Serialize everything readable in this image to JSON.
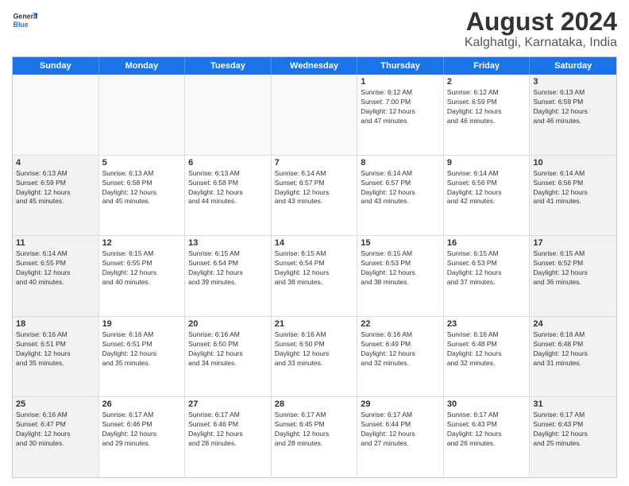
{
  "logo": {
    "line1": "General",
    "line2": "Blue"
  },
  "title": "August 2024",
  "subtitle": "Kalghatgi, Karnataka, India",
  "days": [
    "Sunday",
    "Monday",
    "Tuesday",
    "Wednesday",
    "Thursday",
    "Friday",
    "Saturday"
  ],
  "weeks": [
    [
      {
        "day": "",
        "content": ""
      },
      {
        "day": "",
        "content": ""
      },
      {
        "day": "",
        "content": ""
      },
      {
        "day": "",
        "content": ""
      },
      {
        "day": "1",
        "content": "Sunrise: 6:12 AM\nSunset: 7:00 PM\nDaylight: 12 hours\nand 47 minutes."
      },
      {
        "day": "2",
        "content": "Sunrise: 6:12 AM\nSunset: 6:59 PM\nDaylight: 12 hours\nand 46 minutes."
      },
      {
        "day": "3",
        "content": "Sunrise: 6:13 AM\nSunset: 6:59 PM\nDaylight: 12 hours\nand 46 minutes."
      }
    ],
    [
      {
        "day": "4",
        "content": "Sunrise: 6:13 AM\nSunset: 6:59 PM\nDaylight: 12 hours\nand 45 minutes."
      },
      {
        "day": "5",
        "content": "Sunrise: 6:13 AM\nSunset: 6:58 PM\nDaylight: 12 hours\nand 45 minutes."
      },
      {
        "day": "6",
        "content": "Sunrise: 6:13 AM\nSunset: 6:58 PM\nDaylight: 12 hours\nand 44 minutes."
      },
      {
        "day": "7",
        "content": "Sunrise: 6:14 AM\nSunset: 6:57 PM\nDaylight: 12 hours\nand 43 minutes."
      },
      {
        "day": "8",
        "content": "Sunrise: 6:14 AM\nSunset: 6:57 PM\nDaylight: 12 hours\nand 43 minutes."
      },
      {
        "day": "9",
        "content": "Sunrise: 6:14 AM\nSunset: 6:56 PM\nDaylight: 12 hours\nand 42 minutes."
      },
      {
        "day": "10",
        "content": "Sunrise: 6:14 AM\nSunset: 6:56 PM\nDaylight: 12 hours\nand 41 minutes."
      }
    ],
    [
      {
        "day": "11",
        "content": "Sunrise: 6:14 AM\nSunset: 6:55 PM\nDaylight: 12 hours\nand 40 minutes."
      },
      {
        "day": "12",
        "content": "Sunrise: 6:15 AM\nSunset: 6:55 PM\nDaylight: 12 hours\nand 40 minutes."
      },
      {
        "day": "13",
        "content": "Sunrise: 6:15 AM\nSunset: 6:54 PM\nDaylight: 12 hours\nand 39 minutes."
      },
      {
        "day": "14",
        "content": "Sunrise: 6:15 AM\nSunset: 6:54 PM\nDaylight: 12 hours\nand 38 minutes."
      },
      {
        "day": "15",
        "content": "Sunrise: 6:15 AM\nSunset: 6:53 PM\nDaylight: 12 hours\nand 38 minutes."
      },
      {
        "day": "16",
        "content": "Sunrise: 6:15 AM\nSunset: 6:53 PM\nDaylight: 12 hours\nand 37 minutes."
      },
      {
        "day": "17",
        "content": "Sunrise: 6:15 AM\nSunset: 6:52 PM\nDaylight: 12 hours\nand 36 minutes."
      }
    ],
    [
      {
        "day": "18",
        "content": "Sunrise: 6:16 AM\nSunset: 6:51 PM\nDaylight: 12 hours\nand 35 minutes."
      },
      {
        "day": "19",
        "content": "Sunrise: 6:16 AM\nSunset: 6:51 PM\nDaylight: 12 hours\nand 35 minutes."
      },
      {
        "day": "20",
        "content": "Sunrise: 6:16 AM\nSunset: 6:50 PM\nDaylight: 12 hours\nand 34 minutes."
      },
      {
        "day": "21",
        "content": "Sunrise: 6:16 AM\nSunset: 6:50 PM\nDaylight: 12 hours\nand 33 minutes."
      },
      {
        "day": "22",
        "content": "Sunrise: 6:16 AM\nSunset: 6:49 PM\nDaylight: 12 hours\nand 32 minutes."
      },
      {
        "day": "23",
        "content": "Sunrise: 6:16 AM\nSunset: 6:48 PM\nDaylight: 12 hours\nand 32 minutes."
      },
      {
        "day": "24",
        "content": "Sunrise: 6:16 AM\nSunset: 6:48 PM\nDaylight: 12 hours\nand 31 minutes."
      }
    ],
    [
      {
        "day": "25",
        "content": "Sunrise: 6:16 AM\nSunset: 6:47 PM\nDaylight: 12 hours\nand 30 minutes."
      },
      {
        "day": "26",
        "content": "Sunrise: 6:17 AM\nSunset: 6:46 PM\nDaylight: 12 hours\nand 29 minutes."
      },
      {
        "day": "27",
        "content": "Sunrise: 6:17 AM\nSunset: 6:46 PM\nDaylight: 12 hours\nand 28 minutes."
      },
      {
        "day": "28",
        "content": "Sunrise: 6:17 AM\nSunset: 6:45 PM\nDaylight: 12 hours\nand 28 minutes."
      },
      {
        "day": "29",
        "content": "Sunrise: 6:17 AM\nSunset: 6:44 PM\nDaylight: 12 hours\nand 27 minutes."
      },
      {
        "day": "30",
        "content": "Sunrise: 6:17 AM\nSunset: 6:43 PM\nDaylight: 12 hours\nand 26 minutes."
      },
      {
        "day": "31",
        "content": "Sunrise: 6:17 AM\nSunset: 6:43 PM\nDaylight: 12 hours\nand 25 minutes."
      }
    ]
  ]
}
